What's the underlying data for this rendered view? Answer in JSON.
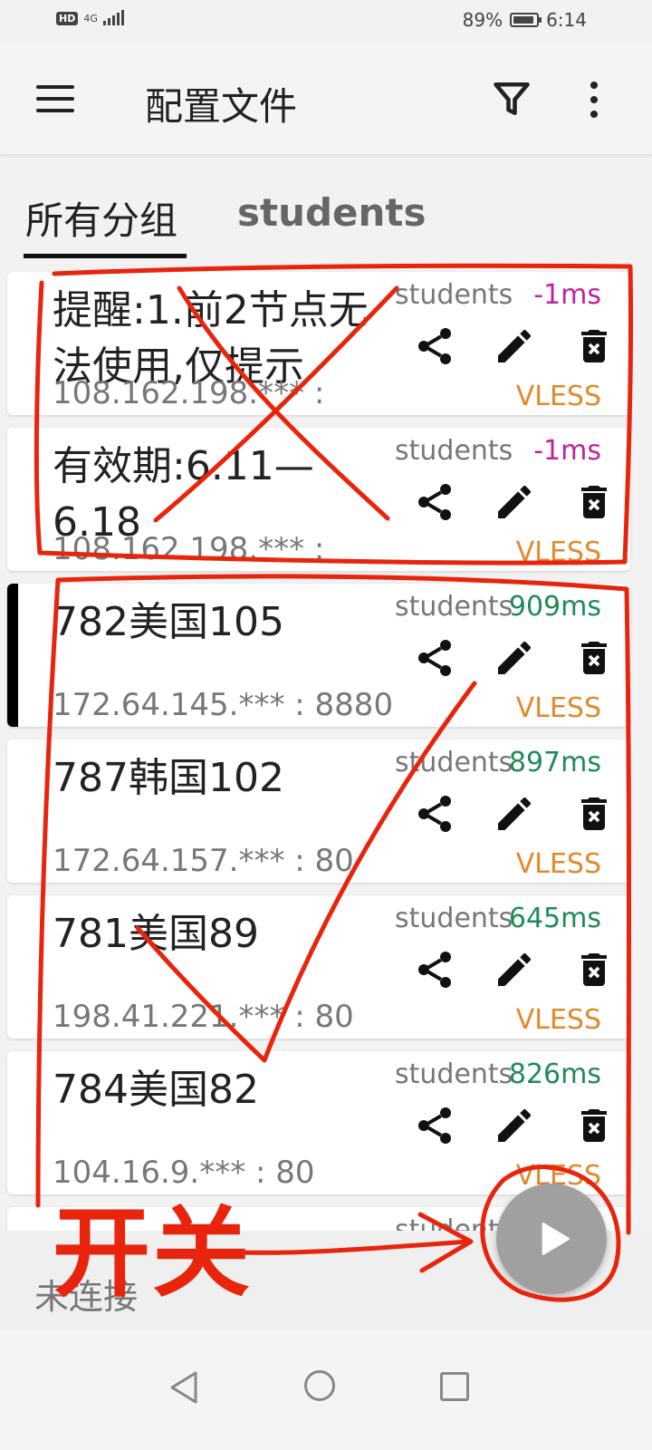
{
  "status_bar": {
    "hd_badge": "HD",
    "network": "4G",
    "battery": "89%",
    "battery_level": 0.89,
    "time": "6:14"
  },
  "app_bar": {
    "title": "配置文件",
    "icons": [
      "menu-icon",
      "filter-icon",
      "more-vert-icon"
    ]
  },
  "tabs": [
    {
      "label": "所有分组",
      "selected": true
    },
    {
      "label": "students",
      "selected": false
    }
  ],
  "servers": [
    {
      "name": "提醒:1.前2节点无法使用,仅提示",
      "address": "108.162.198.*** :",
      "group": "students",
      "latency": "-1ms",
      "latency_color": "#c0229a",
      "type": "VLESS",
      "selected": false
    },
    {
      "name": "有效期:6.11—6.18",
      "address": "108.162.198.*** :",
      "group": "students",
      "latency": "-1ms",
      "latency_color": "#c0229a",
      "type": "VLESS",
      "selected": false
    },
    {
      "name": "782美国105",
      "address": "172.64.145.*** : 8880",
      "group": "students",
      "latency": "909ms",
      "latency_color": "#1f8a5c",
      "type": "VLESS",
      "selected": true
    },
    {
      "name": "787韩国102",
      "address": "172.64.157.*** : 80",
      "group": "students",
      "latency": "897ms",
      "latency_color": "#1f8a5c",
      "type": "VLESS",
      "selected": false
    },
    {
      "name": "781美国89",
      "address": "198.41.221.*** : 80",
      "group": "students",
      "latency": "645ms",
      "latency_color": "#1f8a5c",
      "type": "VLESS",
      "selected": false
    },
    {
      "name": "784美国82",
      "address": "104.16.9.*** : 80",
      "group": "students",
      "latency": "826ms",
      "latency_color": "#1f8a5c",
      "type": "VLESS",
      "selected": false
    },
    {
      "name": "",
      "address": "",
      "group": "students",
      "latency": "",
      "latency_color": "#1f8a5c",
      "type": "",
      "selected": false
    }
  ],
  "bottom": {
    "connection_status": "未连接"
  },
  "annotation": {
    "label": "开关",
    "color": "#e8250c"
  },
  "colors": {
    "type_label": "#e08a2c",
    "fab": "#a0a0a0",
    "selected_indicator": "#000000"
  }
}
